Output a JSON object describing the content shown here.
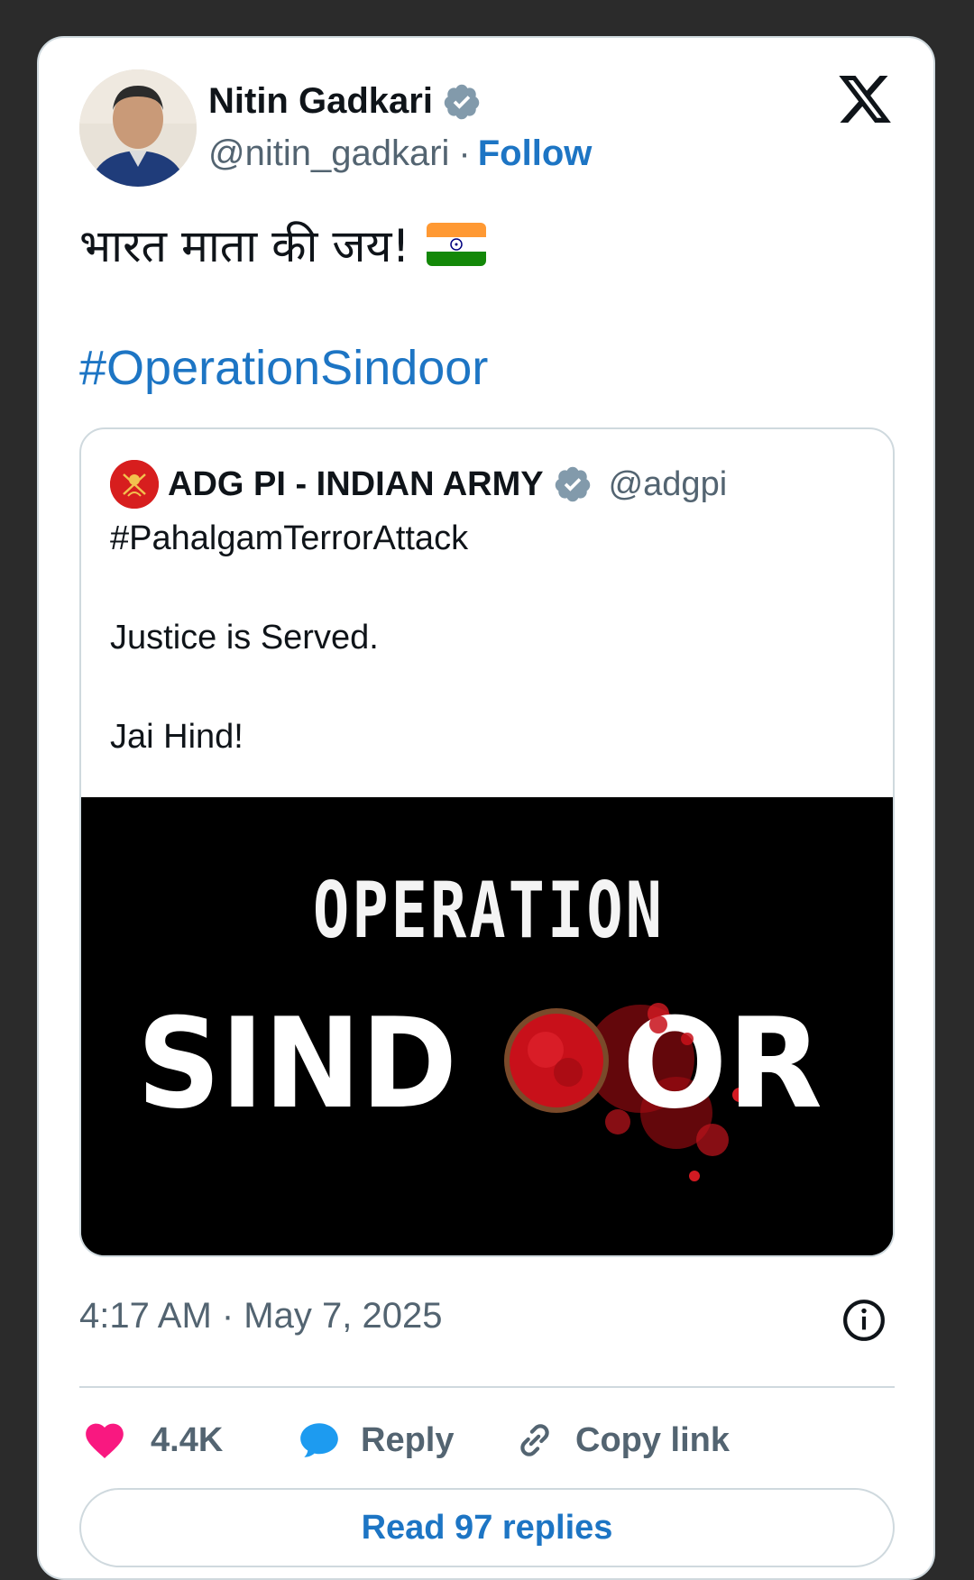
{
  "author": {
    "name": "Nitin Gadkari",
    "handle": "@nitin_gadkari",
    "separator": "·",
    "follow_label": "Follow"
  },
  "tweet": {
    "text": "भारत माता की जय!",
    "hashtag": "#OperationSindoor"
  },
  "quoted_tweet": {
    "name": "ADG PI - INDIAN ARMY",
    "handle": "@adgpi",
    "lines": [
      "#PahalgamTerrorAttack",
      "Justice is Served.",
      "Jai Hind!"
    ],
    "image": {
      "line1": "OPERATION",
      "line2_left": "SIND",
      "line2_right": "OR"
    }
  },
  "timestamp": "4:17 AM · May 7, 2025",
  "actions": {
    "like_count": "4.4K",
    "reply_label": "Reply",
    "copy_label": "Copy link"
  },
  "read_replies_label": "Read 97 replies",
  "colors": {
    "link": "#1d75c4",
    "like": "#f91880",
    "reply": "#1d9bf0",
    "muted": "#536471",
    "verified": "#829aab"
  },
  "icons": [
    "verified-badge-icon",
    "x-logo-icon",
    "india-flag-icon",
    "info-icon",
    "heart-icon",
    "reply-bubble-icon",
    "link-icon"
  ]
}
